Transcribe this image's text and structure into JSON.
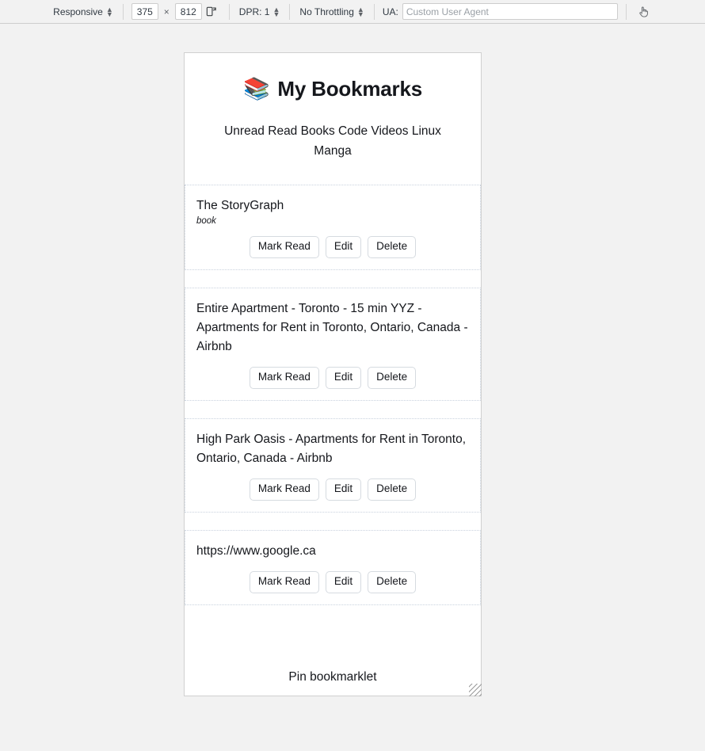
{
  "device_toolbar": {
    "device_preset": "Responsive",
    "width": "375",
    "height": "812",
    "dimension_separator": "×",
    "rotate_icon": "rotate-device-icon",
    "dpr_label": "DPR: 1",
    "throttling_label": "No Throttling",
    "ua_label": "UA:",
    "ua_value": "",
    "ua_placeholder": "Custom User Agent",
    "touch_icon": "touch-hand-icon"
  },
  "page": {
    "title": "My Bookmarks",
    "title_icon": "📚",
    "nav": [
      {
        "label": "Unread"
      },
      {
        "label": "Read"
      },
      {
        "label": "Books"
      },
      {
        "label": "Code"
      },
      {
        "label": "Videos"
      },
      {
        "label": "Linux"
      },
      {
        "label": "Manga"
      }
    ],
    "bookmarks": [
      {
        "title": "The StoryGraph",
        "tag": "book",
        "actions": [
          "Mark Read",
          "Edit",
          "Delete"
        ]
      },
      {
        "title": "Entire Apartment - Toronto - 15 min YYZ - Apartments for Rent in Toronto, Ontario, Canada - Airbnb",
        "tag": "",
        "actions": [
          "Mark Read",
          "Edit",
          "Delete"
        ]
      },
      {
        "title": "High Park Oasis - Apartments for Rent in Toronto, Ontario, Canada - Airbnb",
        "tag": "",
        "actions": [
          "Mark Read",
          "Edit",
          "Delete"
        ]
      },
      {
        "title": "https://www.google.ca",
        "tag": "",
        "actions": [
          "Mark Read",
          "Edit",
          "Delete"
        ]
      }
    ],
    "footer_link": "Pin bookmarklet"
  },
  "colors": {
    "toolbar_bg": "#f2f2f2",
    "page_bg": "#ffffff",
    "text": "#15171c",
    "card_border": "#c9d2de",
    "button_border": "#d6dbe0"
  }
}
